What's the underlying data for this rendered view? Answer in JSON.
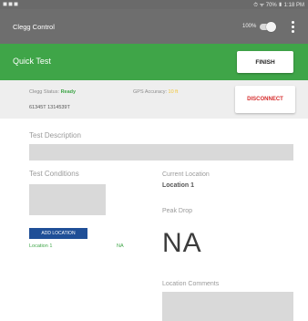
{
  "status_bar": {
    "left_icons": "◼◼◼",
    "right_text": "⏱ ᯤ 70% ▮ 1:18 PM"
  },
  "app_bar": {
    "title": "Clegg Control",
    "battery_percent": "100%",
    "toggle_on": true
  },
  "quick_test_bar": {
    "title": "Quick Test",
    "finish_label": "FINISH",
    "color": "#3fa548"
  },
  "info_bar": {
    "clegg_status_label": "Clegg Status:",
    "clegg_status_value": "Ready",
    "gps_accuracy_label": "GPS Accuracy:",
    "gps_accuracy_value": "10 ft",
    "serial": "61345T 1314539T",
    "disconnect_label": "DISCONNECT"
  },
  "test_description": {
    "label": "Test Description",
    "value": ""
  },
  "test_conditions": {
    "label": "Test Conditions",
    "value": ""
  },
  "current_location": {
    "label": "Current Location",
    "value": "Location 1"
  },
  "peak_drop": {
    "label": "Peak Drop",
    "value": "NA"
  },
  "locations": {
    "add_label": "ADD LOCATION",
    "items": [
      {
        "name": "Location 1",
        "value": "NA"
      }
    ]
  },
  "location_comments": {
    "label": "Location Comments",
    "value": ""
  }
}
